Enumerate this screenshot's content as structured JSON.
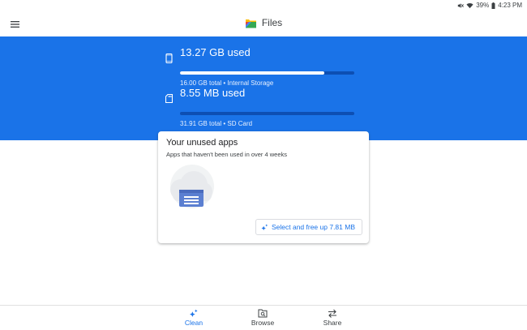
{
  "status_bar": {
    "battery": "39%",
    "time": "4:23 PM"
  },
  "app_bar": {
    "title": "Files",
    "menu_icon": "hamburger-menu-icon",
    "logo_icon": "files-logo-icon"
  },
  "storage": [
    {
      "used": "13.27 GB used",
      "total": "16.00 GB total • Internal Storage",
      "fraction_used": 0.83,
      "icon": "phone-icon"
    },
    {
      "used": "8.55 MB used",
      "total": "31.91 GB total • SD Card",
      "fraction_used": 0.0003,
      "icon": "sd-card-icon"
    }
  ],
  "unused_apps_card": {
    "title": "Your unused apps",
    "subtitle": "Apps that haven't been used in over 4 weeks",
    "button_label": "Select and free up 7.81 MB",
    "button_icon": "sparkle-icon"
  },
  "bottom_nav": {
    "items": [
      {
        "label": "Clean",
        "icon": "sparkle-icon",
        "active": true
      },
      {
        "label": "Browse",
        "icon": "browse-icon",
        "active": false
      },
      {
        "label": "Share",
        "icon": "share-arrows-icon",
        "active": false
      }
    ]
  },
  "colors": {
    "accent": "#1a73e8",
    "band": "#1a73e8",
    "track": "#0d4fb3"
  }
}
